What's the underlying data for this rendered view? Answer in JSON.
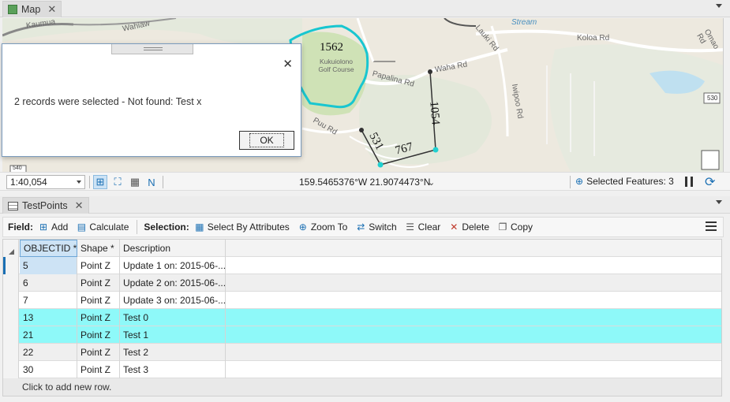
{
  "map_tab": {
    "label": "Map",
    "close": "✕"
  },
  "map": {
    "labels": {
      "road_kaumua": "Kaumua",
      "road_wahiaw": "Wahiaw",
      "golf_course": "Kukuiolono Golf Course",
      "road_papalina": "Papalina Rd",
      "road_waha": "Waha Rd",
      "road_puu": "Puu Rd",
      "road_lauki": "Lauki Rd",
      "road_koloa": "Koloa Rd",
      "road_omao": "Omao Rd",
      "road_iwipoo": "Iwipoo Rd",
      "stream": "Stream",
      "shield_530": "530",
      "shield_540": "540",
      "dim_1562": "1562",
      "dim_1054": "1054",
      "dim_531": "531",
      "dim_767": "767"
    }
  },
  "map_toolbar": {
    "scale": "1:40,054",
    "coordinates": "159.5465376°W 21.9074473°N",
    "selected_features": "Selected Features: 3"
  },
  "dialog": {
    "message": "2 records were selected - Not found: Test x",
    "ok": "OK",
    "close": "✕"
  },
  "table_tab": {
    "label": "TestPoints",
    "close": "✕"
  },
  "table_toolbar": {
    "field_label": "Field:",
    "add": "Add",
    "calculate": "Calculate",
    "selection_label": "Selection:",
    "select_by_attributes": "Select By Attributes",
    "zoom_to": "Zoom To",
    "switch": "Switch",
    "clear": "Clear",
    "delete": "Delete",
    "copy": "Copy"
  },
  "table": {
    "columns": [
      "OBJECTID *",
      "Shape *",
      "Description"
    ],
    "rows": [
      {
        "id": "5",
        "shape": "Point Z",
        "desc": "Update 1 on: 2015-06-...",
        "selected": false
      },
      {
        "id": "6",
        "shape": "Point Z",
        "desc": "Update 2 on: 2015-06-...",
        "selected": false
      },
      {
        "id": "7",
        "shape": "Point Z",
        "desc": "Update 3 on: 2015-06-...",
        "selected": false
      },
      {
        "id": "13",
        "shape": "Point Z",
        "desc": "Test 0",
        "selected": true
      },
      {
        "id": "21",
        "shape": "Point Z",
        "desc": "Test 1",
        "selected": true
      },
      {
        "id": "22",
        "shape": "Point Z",
        "desc": "Test 2",
        "selected": false
      },
      {
        "id": "30",
        "shape": "Point Z",
        "desc": "Test 3",
        "selected": false
      }
    ],
    "add_row": "Click to add new row."
  }
}
